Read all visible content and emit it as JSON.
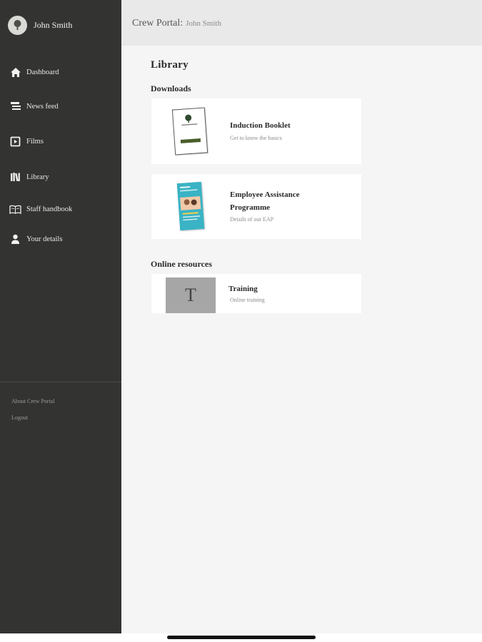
{
  "profile": {
    "name": "John Smith"
  },
  "nav": {
    "items": [
      {
        "label": "Dashboard",
        "icon": "home-icon"
      },
      {
        "label": "News feed",
        "icon": "news-icon"
      },
      {
        "label": "Films",
        "icon": "film-icon"
      },
      {
        "label": "Library",
        "icon": "books-icon"
      },
      {
        "label": "Staff handbook",
        "icon": "open-book-icon"
      },
      {
        "label": "Your details",
        "icon": "person-icon"
      }
    ]
  },
  "footer": {
    "about": "About Crew Portal",
    "logout": "Logout"
  },
  "header": {
    "app": "Crew Portal:",
    "user": "John Smith"
  },
  "main": {
    "title": "Library",
    "downloads_title": "Downloads",
    "downloads": [
      {
        "title": "Induction Booklet",
        "subtitle": "Get to know the basics"
      },
      {
        "title_line1": "Employee Assistance",
        "title_line2": "Programme",
        "subtitle": "Details of our EAP"
      }
    ],
    "online_title": "Online resources",
    "online": [
      {
        "tile_letter": "T",
        "title": "Training",
        "subtitle": "Online training"
      }
    ]
  },
  "colors": {
    "sidebar": "#333331",
    "header": "#e9e9e9",
    "content": "#f5f5f5",
    "eap_accent": "#3ab3c4",
    "booklet_band": "#4a5e2a"
  }
}
